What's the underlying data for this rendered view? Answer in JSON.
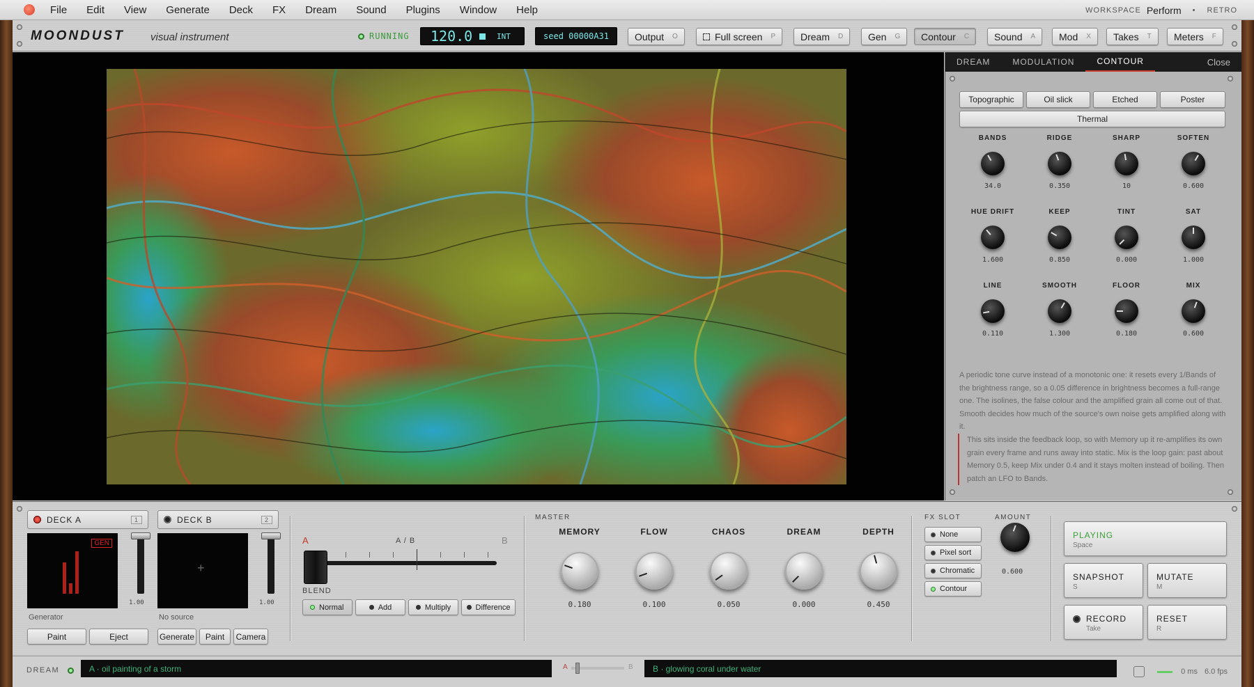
{
  "menubar": {
    "items": [
      "File",
      "Edit",
      "View",
      "Generate",
      "Deck",
      "FX",
      "Dream",
      "Sound",
      "Plugins",
      "Window",
      "Help"
    ],
    "workspace_label": "WORKSPACE",
    "workspace_value": "Perform",
    "retro": "RETRO"
  },
  "toolbar": {
    "brand": "MOONDUST",
    "brand_sub": "visual instrument",
    "status": "RUNNING",
    "bpm": "120.0",
    "clock": "INT",
    "seed": "seed 00000A31",
    "buttons": [
      {
        "label": "Output",
        "key": "O"
      },
      {
        "label": "Full screen",
        "key": "P"
      },
      {
        "label": "Dream",
        "key": "D"
      },
      {
        "label": "Gen",
        "key": "G"
      },
      {
        "label": "Contour",
        "key": "C"
      },
      {
        "label": "Sound",
        "key": "A"
      },
      {
        "label": "Mod",
        "key": "X"
      },
      {
        "label": "Takes",
        "key": "T"
      },
      {
        "label": "Meters",
        "key": "F"
      }
    ]
  },
  "panel": {
    "tabs": [
      "DREAM",
      "MODULATION",
      "CONTOUR"
    ],
    "active_tab": "CONTOUR",
    "close": "Close",
    "presets": [
      "Topographic",
      "Oil slick",
      "Etched",
      "Poster",
      "Thermal"
    ],
    "knobs": [
      {
        "label": "BANDS",
        "value": "34.0"
      },
      {
        "label": "RIDGE",
        "value": "0.350"
      },
      {
        "label": "SHARP",
        "value": "10"
      },
      {
        "label": "SOFTEN",
        "value": "0.600"
      },
      {
        "label": "HUE DRIFT",
        "value": "1.600"
      },
      {
        "label": "KEEP",
        "value": "0.850"
      },
      {
        "label": "TINT",
        "value": "0.000"
      },
      {
        "label": "SAT",
        "value": "1.000"
      },
      {
        "label": "LINE",
        "value": "0.110"
      },
      {
        "label": "SMOOTH",
        "value": "1.300"
      },
      {
        "label": "FLOOR",
        "value": "0.180"
      },
      {
        "label": "MIX",
        "value": "0.600"
      }
    ],
    "description": "A periodic tone curve instead of a monotonic one: it resets every 1/Bands of the brightness range, so a 0.05 difference in brightness becomes a full-range one. The isolines, the false colour and the amplified grain all come out of that. Smooth decides how much of the source's own noise gets amplified along with it.",
    "note": "This sits inside the feedback loop, so with Memory up it re-amplifies its own grain every frame and runs away into static. Mix is the loop gain: past about Memory 0.5, keep Mix under 0.4 and it stays molten instead of boiling. Then patch an LFO to Bands."
  },
  "deck_a": {
    "label": "DECK A",
    "num": "1",
    "badge": "GEN",
    "fader": "1.00",
    "caption": "Generator",
    "buttons": [
      "Paint",
      "Eject"
    ]
  },
  "deck_b": {
    "label": "DECK B",
    "num": "2",
    "fader": "1.00",
    "caption": "No source",
    "buttons": [
      "Generate",
      "Paint",
      "Camera"
    ],
    "plus": "+"
  },
  "crossfader": {
    "a": "A",
    "ab": "A / B",
    "b": "B",
    "blend_label": "BLEND",
    "blend_modes": [
      "Normal",
      "Add",
      "Multiply",
      "Difference"
    ],
    "active": "Normal"
  },
  "master": {
    "label": "MASTER",
    "knobs": [
      {
        "label": "MEMORY",
        "value": "0.180"
      },
      {
        "label": "FLOW",
        "value": "0.100"
      },
      {
        "label": "CHAOS",
        "value": "0.050"
      },
      {
        "label": "DREAM",
        "value": "0.000"
      },
      {
        "label": "DEPTH",
        "value": "0.450"
      }
    ]
  },
  "fx": {
    "label": "FX SLOT",
    "slots": [
      "None",
      "Pixel sort",
      "Chromatic",
      "Contour"
    ],
    "active": "Contour",
    "amount_label": "AMOUNT",
    "amount": "0.600"
  },
  "transport": {
    "playing": {
      "label": "PLAYING",
      "key": "Space"
    },
    "snapshot": {
      "label": "SNAPSHOT",
      "key": "S"
    },
    "mutate": {
      "label": "MUTATE",
      "key": "M"
    },
    "record": {
      "label": "RECORD",
      "key": "Take"
    },
    "reset": {
      "label": "RESET",
      "key": "R"
    }
  },
  "statusbar": {
    "label": "DREAM",
    "prompt_a": "A · oil painting of a storm",
    "slider_a": "A",
    "slider_b": "B",
    "prompt_b": "B · glowing coral under water",
    "latency": "0 ms",
    "fps": "6.0 fps"
  }
}
